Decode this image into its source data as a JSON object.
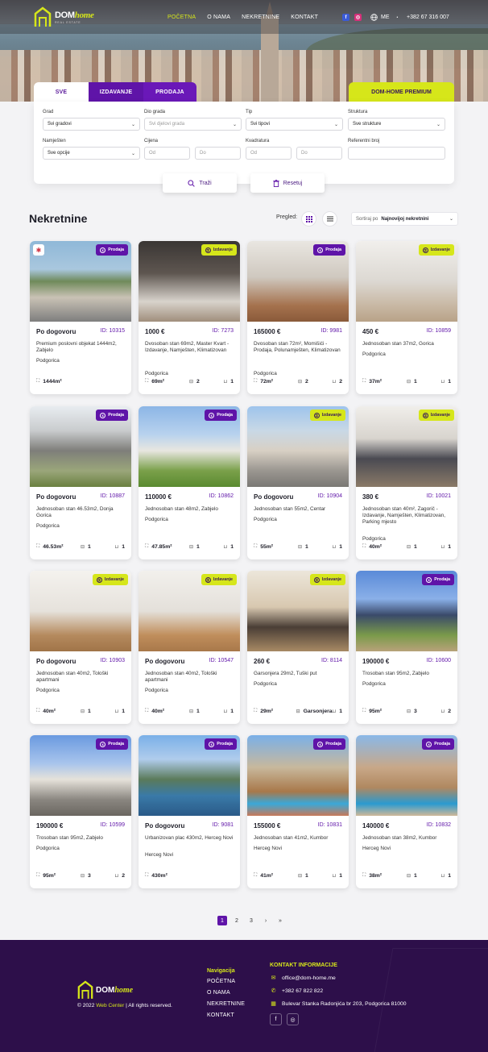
{
  "brand": {
    "name_part1": "DOM",
    "name_part2": "home",
    "tagline": "REAL ESTATE"
  },
  "nav": {
    "items": [
      "POČETNA",
      "O NAMA",
      "NEKRETNINE",
      "KONTAKT"
    ],
    "active": 2
  },
  "topbar": {
    "lang": "ME",
    "phone": "+382 67 316 007"
  },
  "search": {
    "tabs": [
      "SVE",
      "IZDAVANJE",
      "PRODAJA"
    ],
    "premium": "DOM-HOME PREMIUM",
    "fields": {
      "grad": {
        "label": "Grad",
        "value": "Svi gradovi"
      },
      "dio_grada": {
        "label": "Dio grada",
        "value": "Svi djelovi grada"
      },
      "tip": {
        "label": "Tip",
        "value": "Svi tipovi"
      },
      "struktura": {
        "label": "Struktura",
        "value": "Sve strukture"
      },
      "namjesten": {
        "label": "Namješten",
        "value": "Sve opcije"
      },
      "cijena": {
        "label": "Cijena",
        "from": "Od",
        "to": "Do"
      },
      "kvadratura": {
        "label": "Kvadratura",
        "from": "Od",
        "to": "Do"
      },
      "ref": {
        "label": "Referentni broj",
        "value": ""
      }
    },
    "search_btn": "Traži",
    "reset_btn": "Resetuj"
  },
  "listing": {
    "title": "Nekretnine",
    "view_label": "Pregled:",
    "sort_label": "Sortiraj po",
    "sort_value": "Najnovijoj nekretnini"
  },
  "cards": [
    {
      "badge": "Prodaja",
      "type": "p",
      "price": "Po dogovoru",
      "id": "ID: 10315",
      "desc": "Premium poslovni objekat 1444m2, Zabjelo",
      "city": "Podgorica",
      "area": "1444m²",
      "rooms": "",
      "baths": "",
      "pin": true
    },
    {
      "badge": "Izdavanje",
      "type": "i",
      "price": "1000 €",
      "id": "ID: 7273",
      "desc": "Dvosoban stan 69m2, Master Kvart - Izdavanje, Namješten, Klimatizovan",
      "city": "Podgorica",
      "area": "69m²",
      "rooms": "2",
      "baths": "1"
    },
    {
      "badge": "Prodaja",
      "type": "p",
      "price": "165000 €",
      "id": "ID: 9981",
      "desc": "Dvosoban stan 72m², Momišići - Prodaja, Polunamješten, Klimatizovan",
      "city": "Podgorica",
      "area": "72m²",
      "rooms": "2",
      "baths": "2"
    },
    {
      "badge": "Izdavanje",
      "type": "i",
      "price": "450 €",
      "id": "ID: 10859",
      "desc": "Jednosoban stan 37m2, Gorica",
      "city": "Podgorica",
      "area": "37m²",
      "rooms": "1",
      "baths": "1"
    },
    {
      "badge": "Prodaja",
      "type": "p",
      "price": "Po dogovoru",
      "id": "ID: 10887",
      "desc": "Jednosoban stan 46.53m2, Donja Gorica",
      "city": "Podgorica",
      "area": "46.53m²",
      "rooms": "1",
      "baths": "1"
    },
    {
      "badge": "Prodaja",
      "type": "p",
      "price": "110000 €",
      "id": "ID: 10862",
      "desc": "Jednosoban stan 48m2, Zabjelo",
      "city": "Podgorica",
      "area": "47.85m²",
      "rooms": "1",
      "baths": "1"
    },
    {
      "badge": "Izdavanje",
      "type": "i",
      "price": "Po dogovoru",
      "id": "ID: 10904",
      "desc": "Jednosoban stan 55m2, Centar",
      "city": "Podgorica",
      "area": "55m²",
      "rooms": "1",
      "baths": "1"
    },
    {
      "badge": "Izdavanje",
      "type": "i",
      "price": "380 €",
      "id": "ID: 10021",
      "desc": "Jednosoban stan 40m², Zagorič - Izdavanje, Namješten, Klimatizovan, Parking mjesto",
      "city": "Podgorica",
      "area": "40m²",
      "rooms": "1",
      "baths": "1"
    },
    {
      "badge": "Izdavanje",
      "type": "i",
      "price": "Po dogovoru",
      "id": "ID: 10903",
      "desc": "Jednosoban stan 40m2, Tološki apartmani",
      "city": "Podgorica",
      "area": "40m²",
      "rooms": "1",
      "baths": "1"
    },
    {
      "badge": "Izdavanje",
      "type": "i",
      "price": "Po dogovoru",
      "id": "ID: 10547",
      "desc": "Jednosoban stan 40m2, Tološki apartmani",
      "city": "Podgorica",
      "area": "40m²",
      "rooms": "1",
      "baths": "1"
    },
    {
      "badge": "Izdavanje",
      "type": "i",
      "price": "260 €",
      "id": "ID: 8114",
      "desc": "Garsonjera 29m2, Tuški put",
      "city": "Podgorica",
      "area": "29m²",
      "rooms": "Garsonjera",
      "baths": "1"
    },
    {
      "badge": "Prodaja",
      "type": "p",
      "price": "190000 €",
      "id": "ID: 10600",
      "desc": "Trosoban stan 95m2, Zabjelo",
      "city": "Podgorica",
      "area": "95m²",
      "rooms": "3",
      "baths": "2"
    },
    {
      "badge": "Prodaja",
      "type": "p",
      "price": "190000 €",
      "id": "ID: 10599",
      "desc": "Trosoban stan 95m2, Zabjelo",
      "city": "Podgorica",
      "area": "95m²",
      "rooms": "3",
      "baths": "2"
    },
    {
      "badge": "Prodaja",
      "type": "p",
      "price": "Po dogovoru",
      "id": "ID: 9081",
      "desc": "Urbanizovan plac 430m2, Herceg Novi",
      "city": "Herceg Novi",
      "area": "430m²",
      "rooms": "",
      "baths": ""
    },
    {
      "badge": "Prodaja",
      "type": "p",
      "price": "155000 €",
      "id": "ID: 10831",
      "desc": "Jednosoban stan 41m2, Kumbor",
      "city": "Herceg Novi",
      "area": "41m²",
      "rooms": "1",
      "baths": "1"
    },
    {
      "badge": "Prodaja",
      "type": "p",
      "price": "140000 €",
      "id": "ID: 10832",
      "desc": "Jednosoban stan 38m2, Kumbor",
      "city": "Herceg Novi",
      "area": "38m²",
      "rooms": "1",
      "baths": "1"
    }
  ],
  "pagination": {
    "pages": [
      "1",
      "2",
      "3"
    ],
    "next": "›",
    "last": "»"
  },
  "footer": {
    "nav_title": "Navigacija",
    "nav_items": [
      "POČETNA",
      "O NAMA",
      "NEKRETNINE",
      "KONTAKT"
    ],
    "contact_title": "KONTAKT INFORMACIJE",
    "email": "office@dom-home.me",
    "phone": "+382 67 822 822",
    "address": "Bulevar Stanka Radonjića br 203, Podgorica 81000",
    "copy_pre": "© 2022 ",
    "copy_link": "Web Center",
    "copy_post": " | All rights reserved."
  },
  "colors": {
    "brand_purple": "#5f14a8",
    "accent_lime": "#d6e61a",
    "footer_bg": "#2d0f4a"
  }
}
